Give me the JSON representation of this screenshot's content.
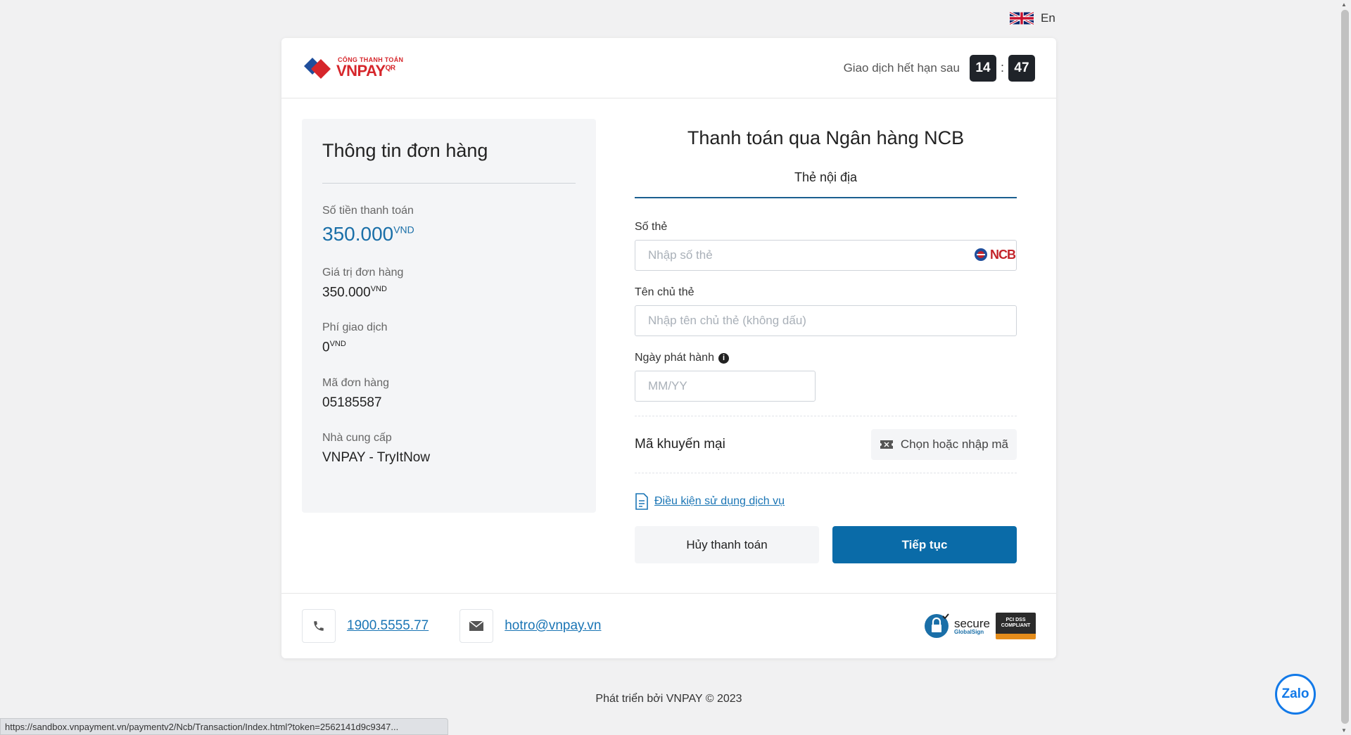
{
  "language": {
    "label": "En"
  },
  "header": {
    "logo_small": "CỔNG THANH TOÁN",
    "logo_big": "VNPAY",
    "logo_suffix": "QR",
    "timer_label": "Giao dịch hết hạn sau",
    "timer_minutes": "14",
    "timer_seconds": "47"
  },
  "order": {
    "title": "Thông tin đơn hàng",
    "amount_label": "Số tiền thanh toán",
    "amount_value": "350.000",
    "order_value_label": "Giá trị đơn hàng",
    "order_value": "350.000",
    "fee_label": "Phí giao dịch",
    "fee_value": "0",
    "order_id_label": "Mã đơn hàng",
    "order_id": "05185587",
    "provider_label": "Nhà cung cấp",
    "provider": "VNPAY - TryItNow",
    "currency": "VND"
  },
  "form": {
    "title": "Thanh toán qua Ngân hàng NCB",
    "tab": "Thẻ nội địa",
    "card_number_label": "Số thẻ",
    "card_number_placeholder": "Nhập số thẻ",
    "bank_logo": "NCB",
    "holder_label": "Tên chủ thẻ",
    "holder_placeholder": "Nhập tên chủ thẻ (không dấu)",
    "issue_date_label": "Ngày phát hành",
    "issue_date_placeholder": "MM/YY",
    "promo_label": "Mã khuyến mại",
    "promo_button": "Chọn hoặc nhập mã",
    "terms_link": "Điều kiện sử dụng dịch vụ",
    "cancel_button": "Hủy thanh toán",
    "continue_button": "Tiếp tục"
  },
  "footer": {
    "phone": "1900.5555.77",
    "email": "hotro@vnpay.vn",
    "secure_text": "secure",
    "secure_sub": "GlobalSign",
    "pci_line1": "PCI DSS",
    "pci_line2": "COMPLIANT"
  },
  "copyright": "Phát triển bởi VNPAY © 2023",
  "status_url": "https://sandbox.vnpayment.vn/paymentv2/Ncb/Transaction/Index.html?token=2562141d9c9347...",
  "zalo": {
    "label": "Zalo"
  },
  "colors": {
    "primary": "#0a6ba8",
    "brand_red": "#d6262b",
    "link": "#1a75b5"
  }
}
